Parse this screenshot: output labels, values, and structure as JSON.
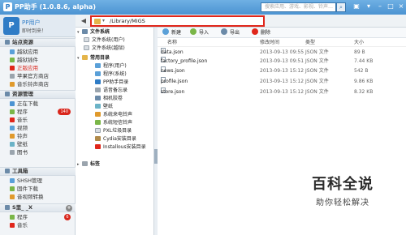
{
  "window": {
    "title": "PP助手 (1.0.8.6, alpha)",
    "search_placeholder": "搜索应用、游戏、影视、铃声…"
  },
  "device": {
    "name": "PP用户",
    "subtitle": "即时到来！"
  },
  "sidebar": {
    "sections": [
      {
        "label": "站点资源",
        "items": [
          {
            "label": "越狱应用"
          },
          {
            "label": "越狱插件"
          },
          {
            "label": "正版应用"
          },
          {
            "label": "苹果官方商店"
          },
          {
            "label": "音乐铃声商店"
          }
        ]
      },
      {
        "label": "资源管理",
        "items": [
          {
            "label": "正在下载"
          },
          {
            "label": "程序",
            "badge": "140"
          },
          {
            "label": "音乐"
          },
          {
            "label": "视频"
          },
          {
            "label": "铃声"
          },
          {
            "label": "壁纸"
          },
          {
            "label": "图书"
          }
        ]
      },
      {
        "label": "工具箱",
        "items": [
          {
            "label": "SHSH管理"
          },
          {
            "label": "固件下载"
          },
          {
            "label": "音视频转换"
          }
        ]
      },
      {
        "label": "S里_ _X",
        "items": [
          {
            "label": "程序",
            "badge": "6"
          },
          {
            "label": "音乐"
          }
        ]
      }
    ]
  },
  "nav": {
    "path": "/Library/MIGS"
  },
  "tree": {
    "groups": [
      {
        "label": "文件系统",
        "items": [
          {
            "label": "文件系统(用户)"
          },
          {
            "label": "文件系统(越狱)"
          }
        ]
      },
      {
        "label": "常用目录",
        "items": [
          {
            "label": "程序(用户)"
          },
          {
            "label": "程序(系统)"
          },
          {
            "label": "PP助手目录"
          },
          {
            "label": "语音备忘录"
          },
          {
            "label": "相机胶卷"
          },
          {
            "label": "壁纸"
          },
          {
            "label": "系统来电铃声"
          },
          {
            "label": "系统短信铃声"
          },
          {
            "label": "PXL垃圾目录"
          },
          {
            "label": "Cydia安装目录"
          },
          {
            "label": "Installous安装目录"
          }
        ]
      },
      {
        "label": "标签",
        "items": []
      }
    ]
  },
  "toolbar": {
    "new_label": "新建",
    "import_label": "导入",
    "export_label": "导出",
    "delete_label": "删除"
  },
  "table": {
    "columns": [
      "名称",
      "修改时间",
      "类型",
      "大小"
    ],
    "rows": [
      {
        "name": "data.json",
        "date": "2013-09-13 09:55",
        "type": "JSON 文件",
        "size": "89 B"
      },
      {
        "name": "factory_profile.json",
        "date": "2013-09-13 09:51",
        "type": "JSON 文件",
        "size": "7.44 KB"
      },
      {
        "name": "news.json",
        "date": "2013-09-13 15:12",
        "type": "JSON 文件",
        "size": "542 B"
      },
      {
        "name": "profile.json",
        "date": "2013-09-13 15:12",
        "type": "JSON 文件",
        "size": "9.86 KB"
      },
      {
        "name": "store.json",
        "date": "2013-09-13 15:12",
        "type": "JSON 文件",
        "size": "8.32 KB"
      }
    ]
  },
  "watermark": {
    "main": "百科全说",
    "sub": "助你轻松解决"
  },
  "colors": {
    "accent": "#4b93d2",
    "highlight": "#e0261b",
    "badge": "#d9261c"
  },
  "icons": [
    "back-icon",
    "folder-icon",
    "search-icon",
    "new-icon",
    "import-icon",
    "export-icon",
    "delete-icon",
    "file-icon"
  ]
}
